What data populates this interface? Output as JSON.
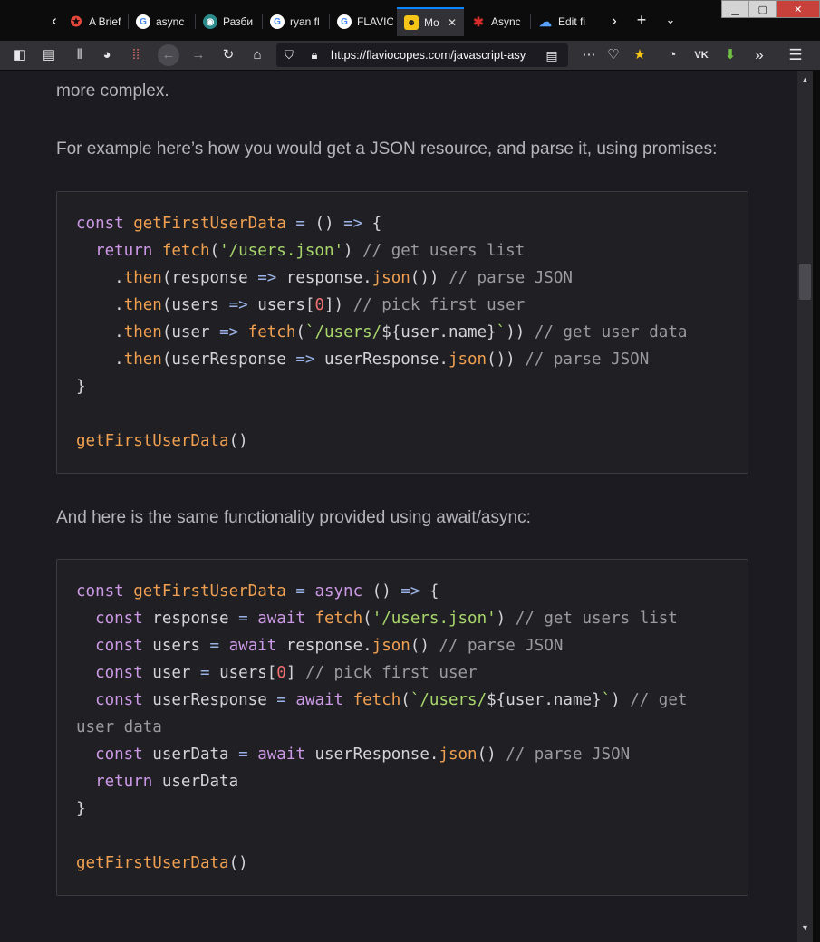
{
  "browser": {
    "tabs": [
      {
        "label": "A Brief",
        "favicon": "star-logo-icon",
        "active": false
      },
      {
        "label": "async",
        "favicon": "google-icon",
        "active": false
      },
      {
        "label": "Разби",
        "favicon": "teal-logo-icon",
        "active": false
      },
      {
        "label": "ryan fl",
        "favicon": "google-icon",
        "active": false
      },
      {
        "label": "FLAVIO",
        "favicon": "google-icon",
        "active": false
      },
      {
        "label": "Mo",
        "favicon": "flaviocopes-icon",
        "active": true
      },
      {
        "label": "Async",
        "favicon": "red-figure-icon",
        "active": false
      },
      {
        "label": "Edit fi",
        "favicon": "cloud-icon",
        "active": false
      }
    ],
    "close_glyph": "✕",
    "url": "https://flaviocopes.com/javascript-asy",
    "accent_color": "#0a84ff"
  },
  "article": {
    "line_intro": "more complex.",
    "para_promises": "For example here’s how you would get a JSON resource, and parse it, using promises:",
    "para_async": "And here is the same functionality provided using await/async:"
  },
  "code_promises": [
    "const getFirstUserData = () => {",
    "  return fetch('/users.json') // get users list",
    "    .then(response => response.json()) // parse JSON",
    "    .then(users => users[0]) // pick first user",
    "    .then(user => fetch(`/users/${user.name}`)) // get user data",
    "    .then(userResponse => userResponse.json()) // parse JSON",
    "}",
    "",
    "getFirstUserData()"
  ],
  "code_async": [
    "const getFirstUserData = async () => {",
    "  const response = await fetch('/users.json') // get users list",
    "  const users = await response.json() // parse JSON",
    "  const user = users[0] // pick first user",
    "  const userResponse = await fetch(`/users/${user.name}`) // get",
    "user data",
    "  const userData = await userResponse.json() // parse JSON",
    "  return userData",
    "}",
    "",
    "getFirstUserData()"
  ]
}
